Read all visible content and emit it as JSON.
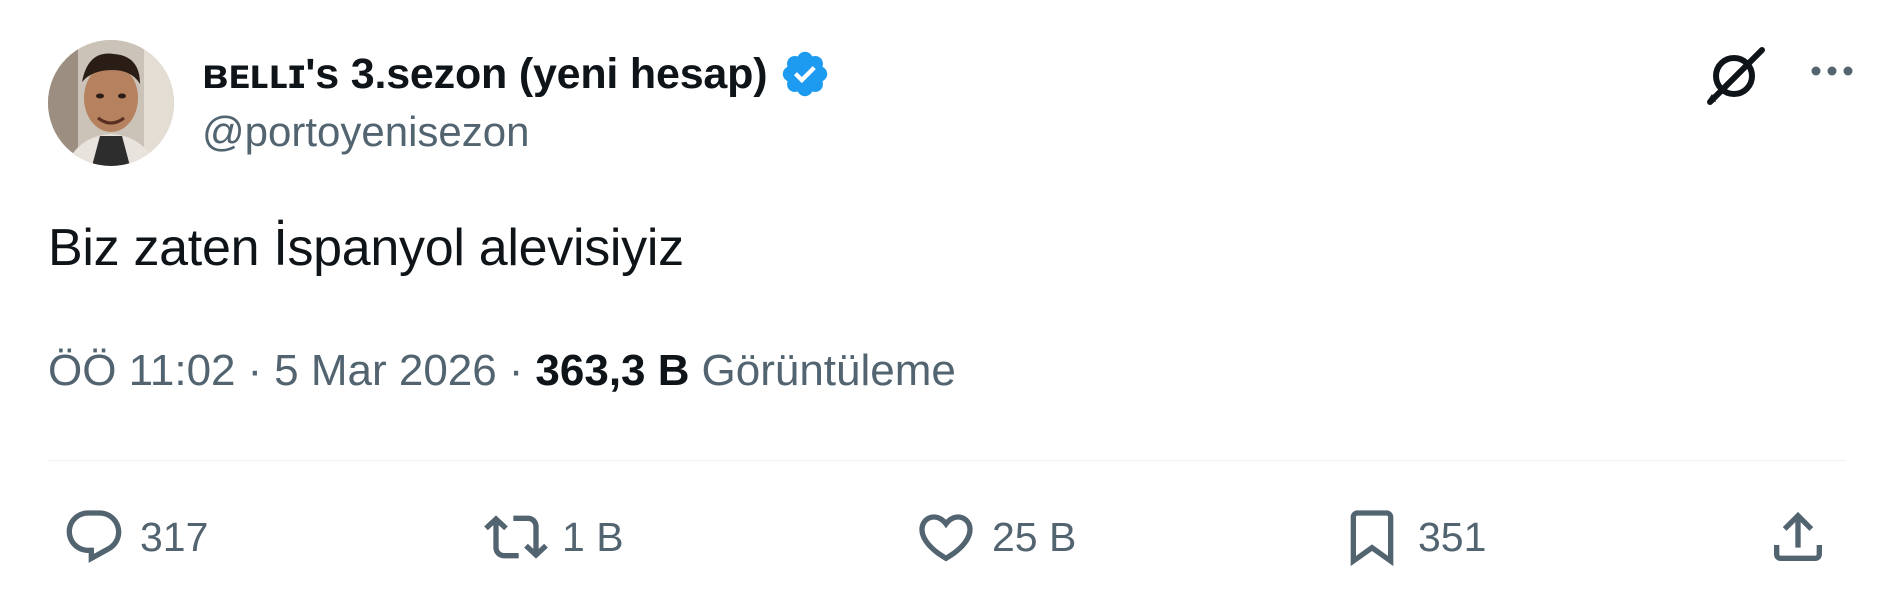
{
  "author": {
    "display_name": "ʙᴇʟʟɪ's 3.sezon (yeni hesap)",
    "handle": "@portoyenisezon",
    "verified": true,
    "avatar_icon": "profile-photo"
  },
  "tweet": {
    "text": "Biz zaten İspanyol alevisiyiz",
    "time": "ÖÖ 11:02",
    "date": "5 Mar 2026",
    "separator": "·",
    "views_count": "363,3 B",
    "views_label": "Görüntüleme"
  },
  "header_icons": {
    "grok": "grok-icon",
    "more": "more-icon"
  },
  "actions": {
    "reply": {
      "icon": "reply-icon",
      "count": "317"
    },
    "retweet": {
      "icon": "retweet-icon",
      "count": "1 B"
    },
    "like": {
      "icon": "heart-icon",
      "count": "25 B"
    },
    "bookmark": {
      "icon": "bookmark-icon",
      "count": "351"
    },
    "share": {
      "icon": "share-icon"
    }
  },
  "colors": {
    "text_primary": "#0f1419",
    "text_secondary": "#536471",
    "verified_blue": "#1d9bf0",
    "divider": "#eff3f4"
  }
}
